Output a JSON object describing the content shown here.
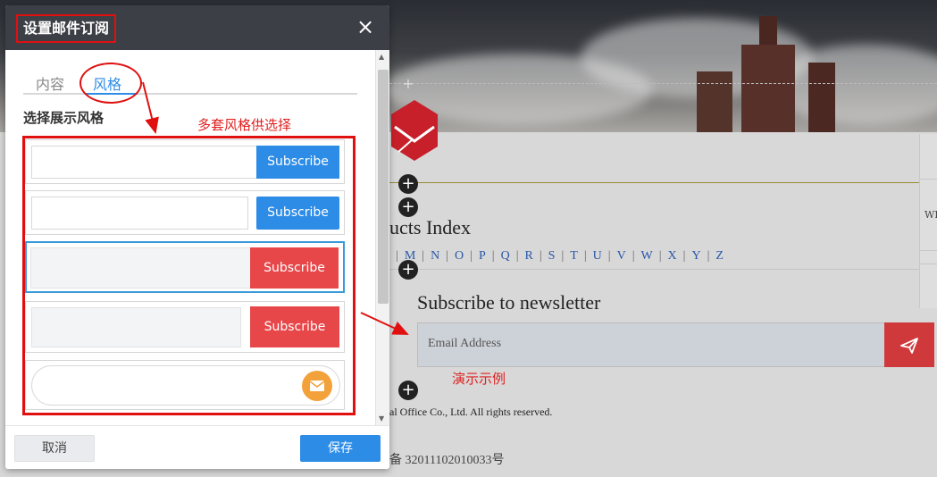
{
  "dialog": {
    "title": "设置邮件订阅",
    "close_glyph": "×",
    "tabs": [
      {
        "label": "内容",
        "active": false
      },
      {
        "label": "风格",
        "active": true
      }
    ],
    "section_label": "选择展示风格",
    "style_options": [
      {
        "button_label": "Subscribe",
        "button_color": "#2d8ce6",
        "selected": false
      },
      {
        "button_label": "Subscribe",
        "button_color": "#2d8ce6",
        "selected": false
      },
      {
        "button_label": "Subscribe",
        "button_color": "#e8474a",
        "selected": true
      },
      {
        "button_label": "Subscribe",
        "button_color": "#e8474a",
        "selected": false
      },
      {
        "button_label": "",
        "button_color": "#f3a13a",
        "selected": false,
        "icon": "envelope-icon"
      }
    ],
    "footer": {
      "cancel_label": "取消",
      "save_label": "保存"
    }
  },
  "annotations": {
    "note_styles": "多套风格供选择",
    "note_demo": "演示示例",
    "color": "#e01010"
  },
  "site": {
    "products_title": "ucts Index",
    "letters": [
      "M",
      "N",
      "O",
      "P",
      "Q",
      "R",
      "S",
      "T",
      "U",
      "V",
      "W",
      "X",
      "Y",
      "Z"
    ],
    "newsletter_title": "Subscribe to newsletter",
    "email_placeholder": "Email Address",
    "send_icon": "paper-plane-icon",
    "copyright": "al Office Co., Ltd. All rights reserved.",
    "icp": "备 32011102010033号",
    "right_panel_text": "WI",
    "accent_red": "#d0393c"
  }
}
